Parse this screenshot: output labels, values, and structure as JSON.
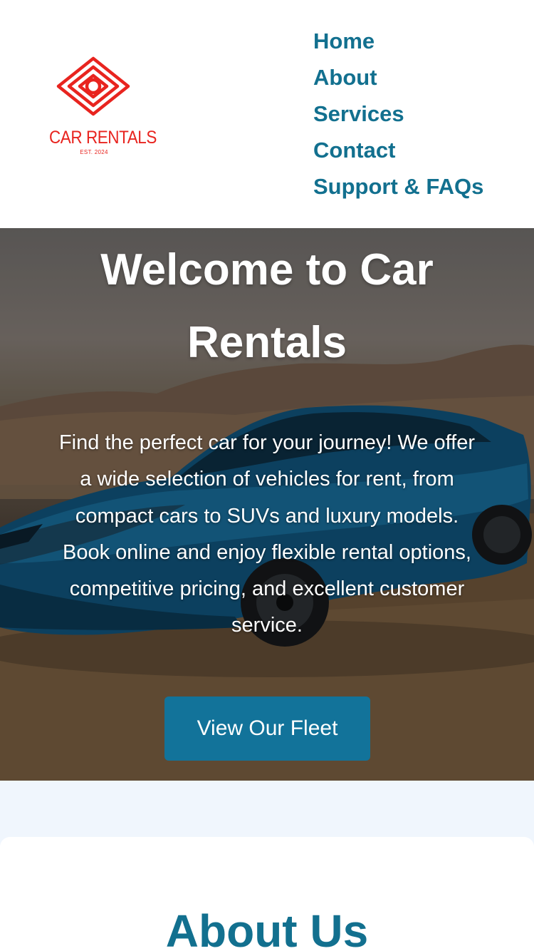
{
  "logo": {
    "name": "CAR RENTALS",
    "tagline": "EST. 2024",
    "color": "#e8241f"
  },
  "nav": {
    "items": [
      "Home",
      "About",
      "Services",
      "Contact",
      "Support & FAQs"
    ],
    "color": "#12708f"
  },
  "hero": {
    "title": "Welcome to Car Rentals",
    "description": "Find the perfect car for your journey! We offer a wide selection of vehicles for rent, from compact cars to SUVs and luxury models. Book online and enjoy flexible rental options, competitive pricing, and excellent customer service.",
    "cta_label": "View Our Fleet",
    "cta_color": "#12739a",
    "background_image": "blue sports car parked on dirt road with hills at sunset"
  },
  "about": {
    "title": "About Us"
  }
}
